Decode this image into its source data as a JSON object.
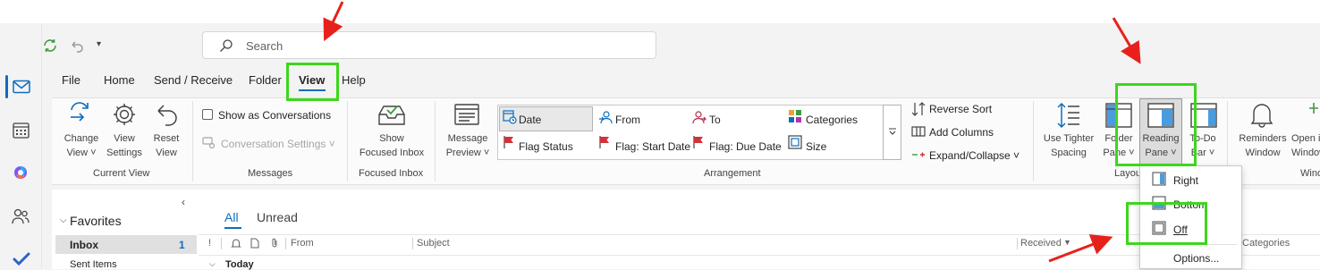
{
  "search": {
    "placeholder": "Search"
  },
  "menu": [
    {
      "label": "File"
    },
    {
      "label": "Home"
    },
    {
      "label": "Send / Receive"
    },
    {
      "label": "Folder"
    },
    {
      "label": "View"
    },
    {
      "label": "Help"
    }
  ],
  "ribbon": {
    "current_view": {
      "group": "Current View",
      "buttons": [
        {
          "line1": "Change",
          "line2": "View ˅"
        },
        {
          "line1": "View",
          "line2": "Settings"
        },
        {
          "line1": "Reset",
          "line2": "View"
        }
      ]
    },
    "messages": {
      "group": "Messages",
      "show_conversations": "Show as Conversations",
      "conversation_settings": "Conversation Settings ˅"
    },
    "focused_inbox": {
      "group": "Focused Inbox",
      "line1": "Show",
      "line2": "Focused Inbox"
    },
    "arrangement": {
      "group": "Arrangement",
      "message_preview": {
        "line1": "Message",
        "line2": "Preview ˅"
      },
      "items": [
        {
          "label": "Date"
        },
        {
          "label": "From"
        },
        {
          "label": "To"
        },
        {
          "label": "Categories"
        },
        {
          "label": "Flag Status"
        },
        {
          "label": "Flag: Start Date"
        },
        {
          "label": "Flag: Due Date"
        },
        {
          "label": "Size"
        }
      ],
      "reverse_sort": "Reverse Sort",
      "add_columns": "Add Columns",
      "expand_collapse": "Expand/Collapse ˅"
    },
    "layout": {
      "group": "Layout",
      "tighter": {
        "line1": "Use Tighter",
        "line2": "Spacing"
      },
      "folder_pane": {
        "line1": "Folder",
        "line2": "Pane ˅"
      },
      "reading_pane": {
        "line1": "Reading",
        "line2": "Pane ˅"
      },
      "todo_bar": {
        "line1": "To-Do",
        "line2": "Bar ˅"
      }
    },
    "window": {
      "group": "Window",
      "reminders": {
        "line1": "Reminders",
        "line2": "Window"
      },
      "open": {
        "line1": "Open in New",
        "line2": "Window"
      }
    }
  },
  "reading_pane_menu": [
    {
      "label": "Right"
    },
    {
      "label": "Bottom"
    },
    {
      "label": "Off"
    },
    {
      "label": "Options..."
    }
  ],
  "folders": {
    "favorites": "Favorites",
    "items": [
      {
        "label": "Inbox",
        "count": "1"
      },
      {
        "label": "Sent Items",
        "count": ""
      }
    ]
  },
  "mail_list": {
    "tabs": [
      {
        "label": "All"
      },
      {
        "label": "Unread"
      }
    ],
    "columns": {
      "from": "From",
      "subject": "Subject",
      "received": "Received",
      "categories": "Categories"
    },
    "group_today": "Today"
  },
  "colors": {
    "accent": "#0f6cbd",
    "highlight": "#3ed61c",
    "arrow": "#e8201b"
  }
}
